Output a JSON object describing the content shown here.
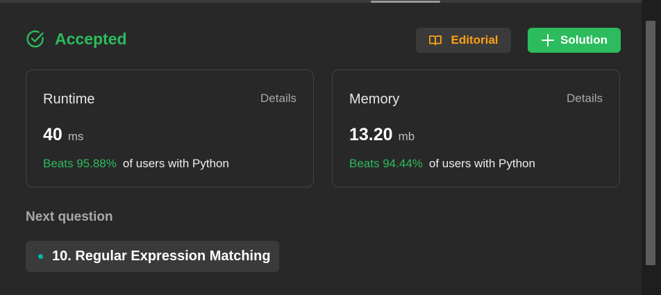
{
  "status": {
    "label": "Accepted",
    "color": "#2cbb5d",
    "icon": "check-circle-icon"
  },
  "actions": {
    "editorial": {
      "label": "Editorial",
      "icon": "book-open-icon",
      "color": "#ffa116"
    },
    "solution": {
      "label": "Solution",
      "icon": "plus-icon",
      "color": "#2cbb5d"
    }
  },
  "runtime": {
    "title": "Runtime",
    "details_label": "Details",
    "value": "40",
    "unit": "ms",
    "beats": "Beats 95.88%",
    "beats_suffix": "of users with Python"
  },
  "memory": {
    "title": "Memory",
    "details_label": "Details",
    "value": "13.20",
    "unit": "mb",
    "beats": "Beats 94.44%",
    "beats_suffix": "of users with Python"
  },
  "next": {
    "label": "Next question",
    "question": "10. Regular Expression Matching",
    "difficulty_color": "#00b8a3"
  }
}
